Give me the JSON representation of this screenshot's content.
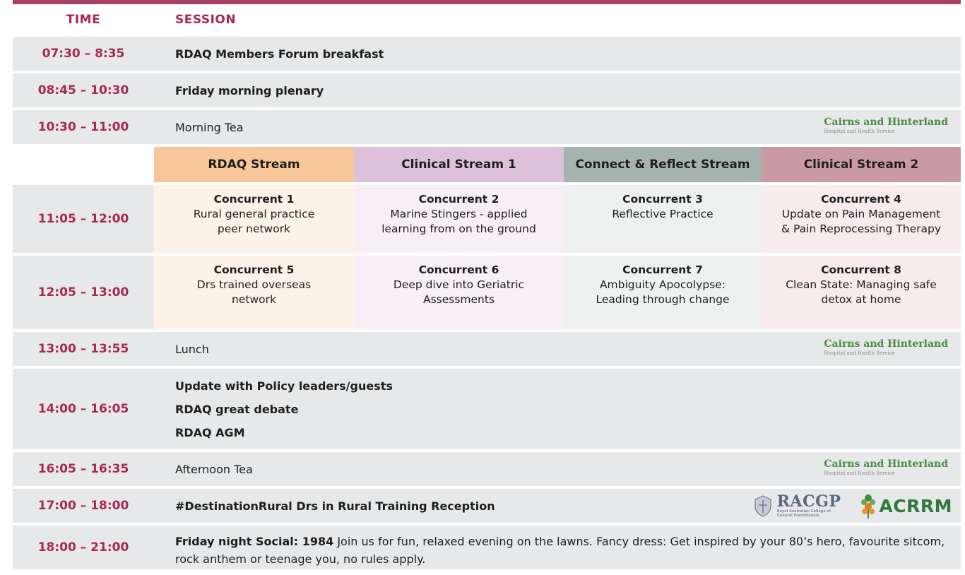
{
  "header": {
    "time_label": "TIME",
    "session_label": "SESSION"
  },
  "rows": [
    {
      "time": "07:30 – 8:35",
      "session": "RDAQ Members Forum breakfast"
    },
    {
      "time": "08:45 – 10:30",
      "session": "Friday morning plenary"
    },
    {
      "time": "10:30 – 11:00",
      "session": "Morning Tea"
    },
    {
      "time": "13:00 – 13:55",
      "session": "Lunch"
    },
    {
      "time": "14:00 – 16:05",
      "sessions": [
        "Update with Policy leaders/guests",
        "RDAQ great debate",
        "RDAQ AGM"
      ]
    },
    {
      "time": "16:05 – 16:35",
      "session": "Afternoon Tea"
    },
    {
      "time": "17:00 – 18:00",
      "session": "#DestinationRural Drs in Rural Training Reception"
    },
    {
      "time": "18:00 – 21:00",
      "session_bold": "Friday night Social: 1984",
      "session_rest": " Join us for fun, relaxed evening on the lawns. Fancy dress: Get inspired by your 80’s hero, favourite sitcom, rock anthem or teenage you, no rules apply."
    }
  ],
  "streams": [
    "RDAQ Stream",
    "Clinical Stream 1",
    "Connect & Reflect Stream",
    "Clinical Stream 2"
  ],
  "concurrent_rows": [
    {
      "time": "11:05 – 12:00",
      "items": [
        {
          "title": "Concurrent 1",
          "l1": "Rural general practice",
          "l2": "peer network"
        },
        {
          "title": "Concurrent 2",
          "l1": "Marine Stingers - applied",
          "l2": "learning from on the ground"
        },
        {
          "title": "Concurrent 3",
          "l1": "Reflective Practice",
          "l2": ""
        },
        {
          "title": "Concurrent 4",
          "l1": "Update on Pain Management",
          "l2": "& Pain Reprocessing Therapy"
        }
      ]
    },
    {
      "time": "12:05 – 13:00",
      "items": [
        {
          "title": "Concurrent 5",
          "l1": "Drs trained overseas",
          "l2": "network"
        },
        {
          "title": "Concurrent 6",
          "l1": "Deep dive into Geriatric",
          "l2": "Assessments"
        },
        {
          "title": "Concurrent 7",
          "l1": "Ambiguity Apocolypse:",
          "l2": "Leading through change"
        },
        {
          "title": "Concurrent 8",
          "l1": "Clean State: Managing safe",
          "l2": "detox at home"
        }
      ]
    }
  ],
  "logos": {
    "cairns_l1": "Cairns and Hinterland",
    "cairns_l2": "Hospital and Health Service",
    "racgp": "RACGP",
    "racgp_sub": "Royal Australian College of General Practitioners",
    "acrrm": "ACRRM"
  },
  "colors": {
    "accent": "#a8294f",
    "row_bg": "#e6e8ea",
    "rdaq_stream": "#f7c79a",
    "clinical_stream_1": "#ddc1db",
    "connect_reflect_stream": "#a6b2ae",
    "clinical_stream_2": "#c99aa3"
  }
}
